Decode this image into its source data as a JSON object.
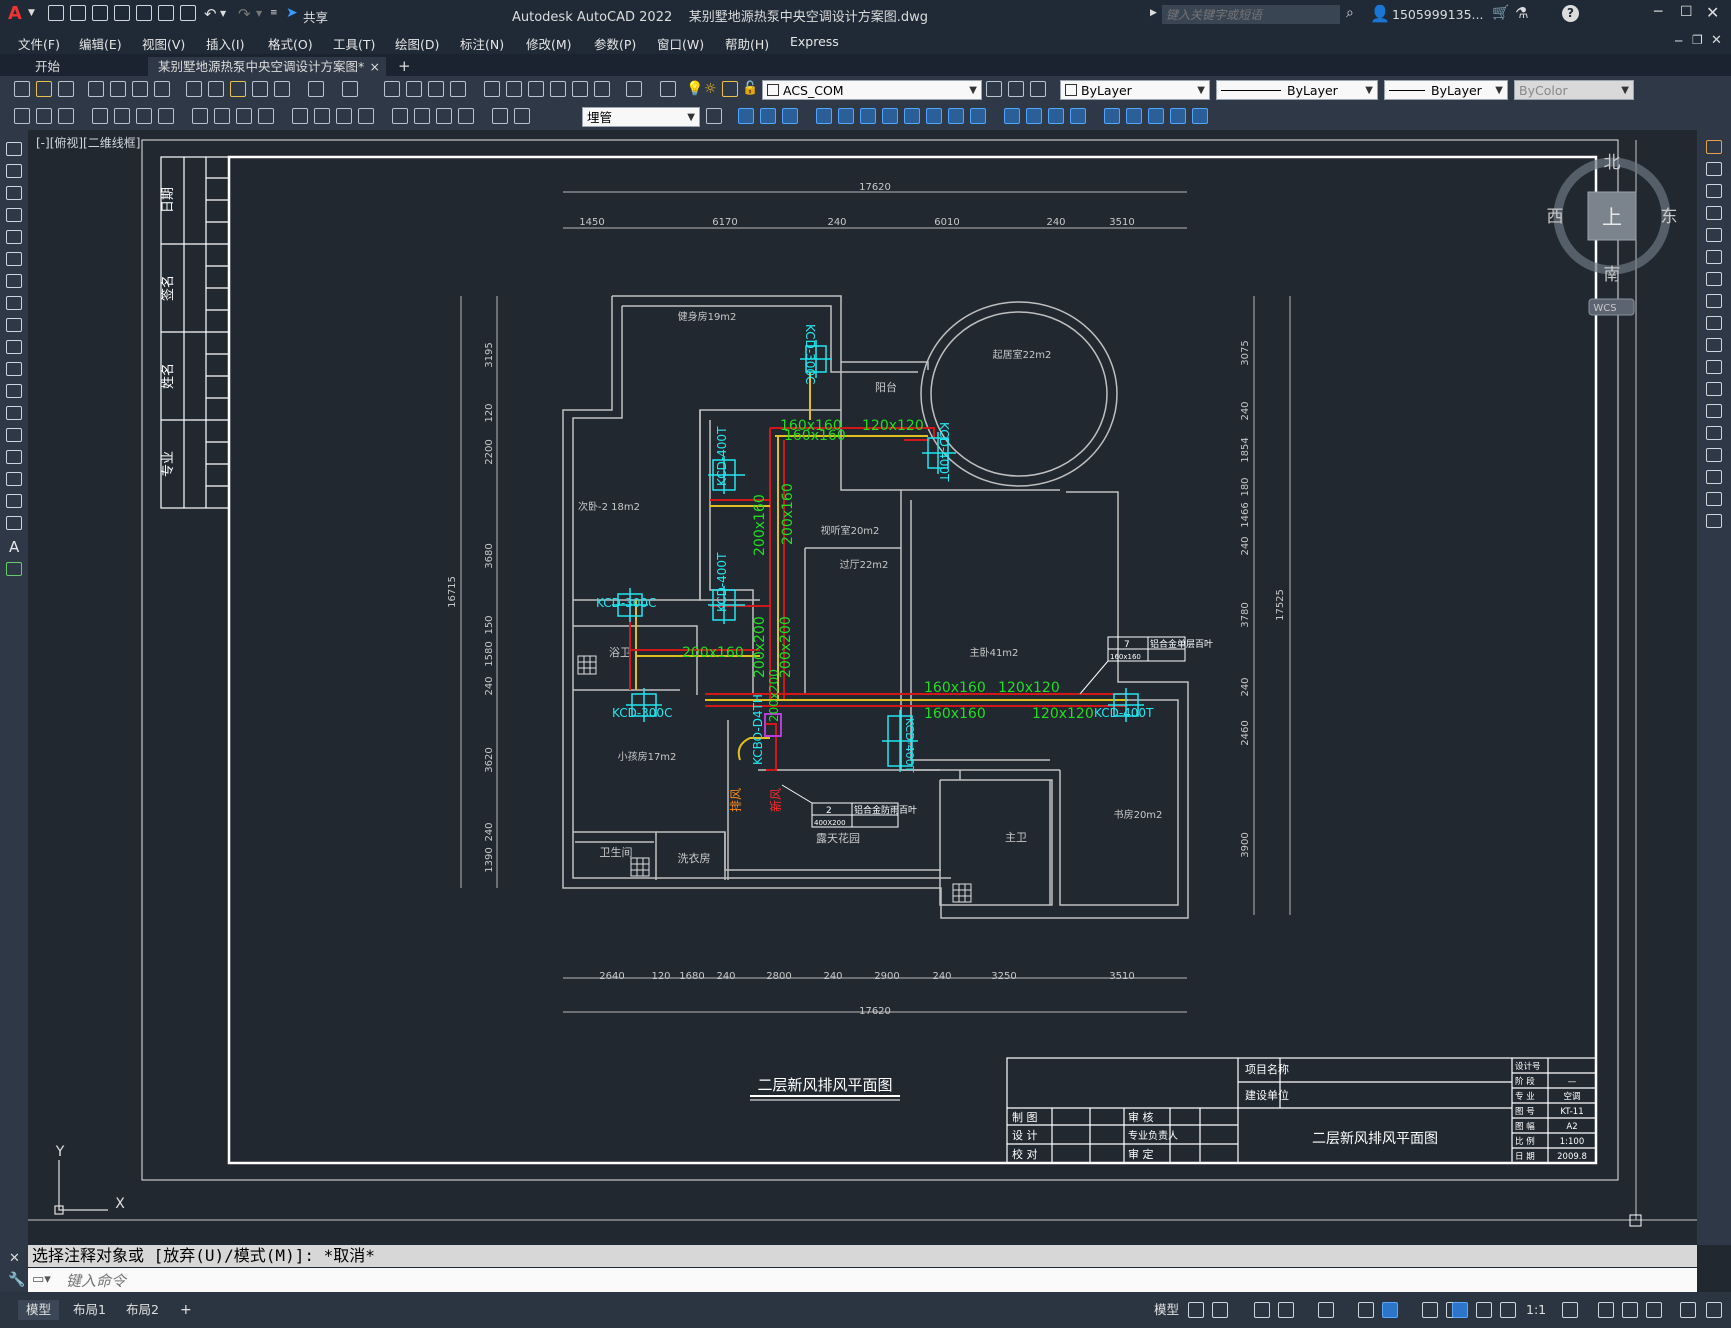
{
  "window": {
    "app_title": "Autodesk AutoCAD 2022",
    "file_name": "某别墅地源热泵中央空调设计方案图.dwg",
    "share_label": "共享",
    "search_placeholder": "键入关键字或短语",
    "user_name": "1505999135...",
    "help_label": "?"
  },
  "menu": [
    "文件(F)",
    "编辑(E)",
    "视图(V)",
    "插入(I)",
    "格式(O)",
    "工具(T)",
    "绘图(D)",
    "标注(N)",
    "修改(M)",
    "参数(P)",
    "窗口(W)",
    "帮助(H)",
    "Express"
  ],
  "tabs": {
    "start": "开始",
    "active": "某别墅地源热泵中央空调设计方案图*",
    "close": "×",
    "add": "+"
  },
  "toolbar": {
    "layer_current": "ACS_COM",
    "color_value": "ByLayer",
    "linetype_value": "ByLayer",
    "lineweight_value": "ByLayer",
    "plotstyle_value": "ByColor",
    "style_value": "埋管"
  },
  "viewport": {
    "label": "[-][俯视][二维线框]",
    "viewcube": {
      "north": "北",
      "south": "南",
      "east": "东",
      "west": "西",
      "top": "上",
      "wcs": "WCS"
    },
    "ucs": {
      "x": "X",
      "y": "Y"
    }
  },
  "drawing": {
    "title": "二层新风排风平面图",
    "dims_top_total": "17620",
    "dims_top": [
      "1450",
      "6170",
      "240",
      "6010",
      "240",
      "3510"
    ],
    "dims_bottom_total": "17620",
    "dims_bottom": [
      "2640",
      "120",
      "1680",
      "240",
      "2800",
      "240",
      "2900",
      "240",
      "3250",
      "3510"
    ],
    "dims_left_total": "16715",
    "dims_left": [
      "3195",
      "120",
      "2200",
      "3680",
      "150",
      "1580",
      "240",
      "3620",
      "240",
      "1390"
    ],
    "dims_right_total": "17525",
    "dims_right": [
      "3075",
      "240",
      "1854",
      "180",
      "1466",
      "240",
      "3780",
      "240",
      "2460",
      "3900"
    ],
    "rooms": {
      "gym": "健身房19m2",
      "living": "起居室22m2",
      "balcony": "阳台",
      "bedroom2": "次卧-2 18m2",
      "av_room": "视听室20m2",
      "hall": "过厅22m2",
      "bath_a": "浴卫",
      "master": "主卧41m2",
      "kids": "小孩房17m2",
      "toilet": "卫生间",
      "laundry": "洗衣房",
      "garden": "露天花园",
      "master_bath": "主卫",
      "study": "书房20m2"
    },
    "ducts": [
      "160x160",
      "120x120",
      "160x160",
      "200x160",
      "200x160",
      "200x200",
      "200x160",
      "200x200",
      "200x200",
      "160x160",
      "120x120",
      "160x160",
      "120x120"
    ],
    "units": [
      "KCD-300C",
      "KCD-400T",
      "KCD-400T",
      "KCD-300C",
      "KCD-400T",
      "KCD-300C",
      "KCD-400T",
      "KCD-400T"
    ],
    "main_unit": "KCBO-D4TH",
    "labels": {
      "exhaust": "排风",
      "fresh": "新风"
    },
    "callouts": [
      {
        "num": "7",
        "text": "铝合金单层百叶",
        "size": "160x160"
      },
      {
        "num": "2",
        "text": "铝合金防雨百叶",
        "size": "400X200"
      }
    ],
    "left_table": [
      "日期",
      "签名",
      "姓名",
      "专业"
    ],
    "title_block": {
      "project_name": "项目名称",
      "build_unit": "建设单位",
      "rows_left": [
        [
          "制 图",
          "审 核"
        ],
        [
          "设 计",
          "专业负责人"
        ],
        [
          "校 对",
          "审 定"
        ]
      ],
      "drawing_title": "二层新风排风平面图",
      "right_labels": [
        "设计号",
        "阶 段",
        "专 业",
        "图 号",
        "图 幅",
        "比 例",
        "日 期"
      ],
      "right_values": [
        "",
        "—",
        "空调",
        "KT-11",
        "A2",
        "1:100",
        "2009.8"
      ]
    }
  },
  "command": {
    "history": "选择注释对象或 [放弃(U)/模式(M)]: *取消*",
    "placeholder": "键入命令"
  },
  "status": {
    "tabs": [
      "模型",
      "布局1",
      "布局2"
    ],
    "add": "+",
    "model_label": "模型",
    "scale": "1:1"
  },
  "colors": {
    "cad_bg": "#212830",
    "duct_red": "#d01818",
    "duct_yellow": "#e0c020",
    "text_green": "#22dd22",
    "unit_cyan": "#22e6f0"
  }
}
